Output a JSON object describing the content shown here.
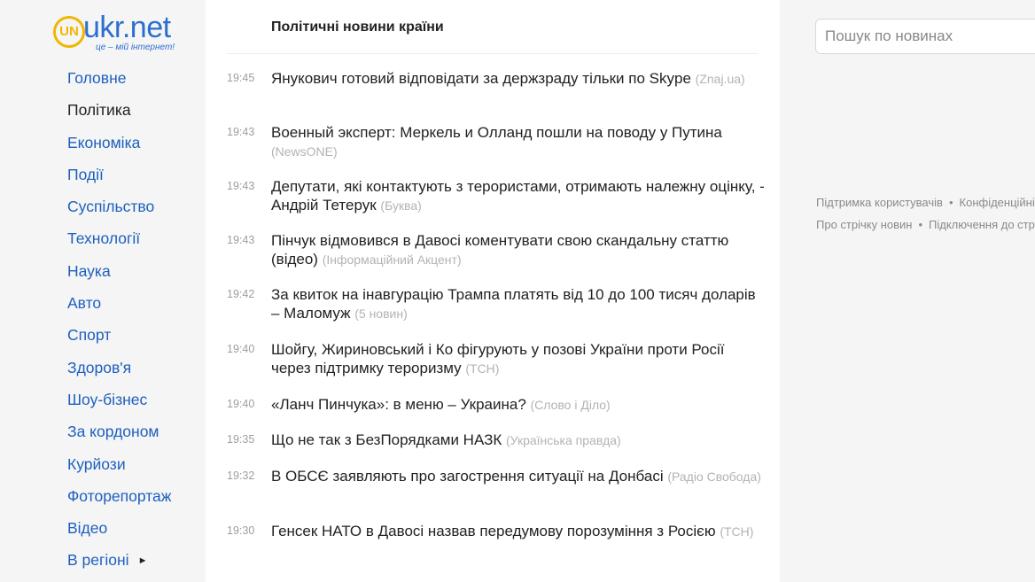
{
  "logo": {
    "mark": "UN",
    "name": "ukr.net",
    "tagline": "це – мій інтернет!"
  },
  "sidebar": {
    "items": [
      {
        "label": "Головне",
        "active": false
      },
      {
        "label": "Політика",
        "active": true
      },
      {
        "label": "Економіка",
        "active": false
      },
      {
        "label": "Події",
        "active": false
      },
      {
        "label": "Суспільство",
        "active": false
      },
      {
        "label": "Технології",
        "active": false
      },
      {
        "label": "Наука",
        "active": false
      },
      {
        "label": "Авто",
        "active": false
      },
      {
        "label": "Спорт",
        "active": false
      },
      {
        "label": "Здоров'я",
        "active": false
      },
      {
        "label": "Шоу-бізнес",
        "active": false
      },
      {
        "label": "За кордоном",
        "active": false
      },
      {
        "label": "Курйози",
        "active": false
      },
      {
        "label": "Фоторепортаж",
        "active": false
      },
      {
        "label": "Відео",
        "active": false
      },
      {
        "label": "В регіоні",
        "active": false,
        "arrow": "►"
      }
    ]
  },
  "main": {
    "section_title": "Політичні новини країни",
    "news": [
      {
        "time": "19:45",
        "title": "Янукович готовий відповідати за держзраду тільки по Skype",
        "source": "(Znaj.ua)"
      },
      {
        "time": "19:43",
        "title": "Военный эксперт: Меркель и Олланд пошли на поводу у Путина",
        "source": "(NewsONE)"
      },
      {
        "time": "19:43",
        "title": "Депутати, які контактують з терористами, отримають належну оцінку, - Андрій Тетерук",
        "source": "(Буква)"
      },
      {
        "time": "19:43",
        "title": "Пінчук відмовився в Давосі коментувати свою скандальну статтю (відео)",
        "source": "(Інформаційний Акцент)"
      },
      {
        "time": "19:42",
        "title": "За квиток на інавгурацію Трампа платять від 10 до 100 тисяч доларів – Маломуж",
        "source": "(5 новин)"
      },
      {
        "time": "19:40",
        "title": "Шойгу, Жириновський і Ко фігурують у позові України проти Росії через підтримку тероризму",
        "source": "(ТСН)"
      },
      {
        "time": "19:40",
        "title": "«Ланч Пинчука»: в меню – Украина?",
        "source": "(Слово і Діло)"
      },
      {
        "time": "19:35",
        "title": "Що не так з БезПорядками НАЗК",
        "source": "(Українська правда)"
      },
      {
        "time": "19:32",
        "title": "В ОБСЄ заявляють про загострення ситуації на Донбасі",
        "source": "(Радіо Свобода)"
      },
      {
        "time": "19:30",
        "title": "Генсек НАТО в Давосі назвав передумову порозуміння з Росією",
        "source": "(ТСН)"
      }
    ]
  },
  "right": {
    "search_placeholder": "Пошук по новинах",
    "footer_row1": {
      "a": "Підтримка користувачів",
      "b": "Конфіденційність"
    },
    "footer_row2": {
      "a": "Про стрічку новин",
      "b": "Підключення до стрічки"
    },
    "separator": "•"
  }
}
